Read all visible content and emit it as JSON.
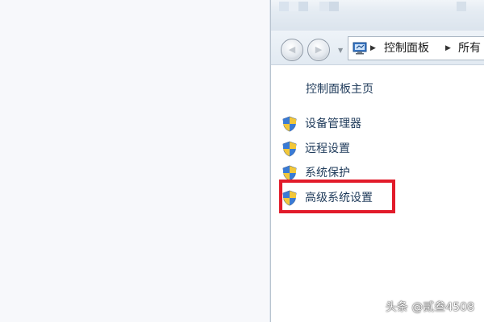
{
  "address_bar": {
    "path": [
      "控制面板",
      "所有"
    ]
  },
  "sidebar": {
    "home_label": "控制面板主页",
    "tasks": [
      {
        "label": "设备管理器",
        "icon": "uac-shield-icon"
      },
      {
        "label": "远程设置",
        "icon": "uac-shield-icon"
      },
      {
        "label": "系统保护",
        "icon": "uac-shield-icon"
      },
      {
        "label": "高级系统设置",
        "icon": "uac-shield-icon"
      }
    ]
  },
  "highlight": {
    "target": "高级系统设置",
    "color": "#e21b2a"
  },
  "watermark": {
    "text": "头条 @贰叁4508"
  }
}
